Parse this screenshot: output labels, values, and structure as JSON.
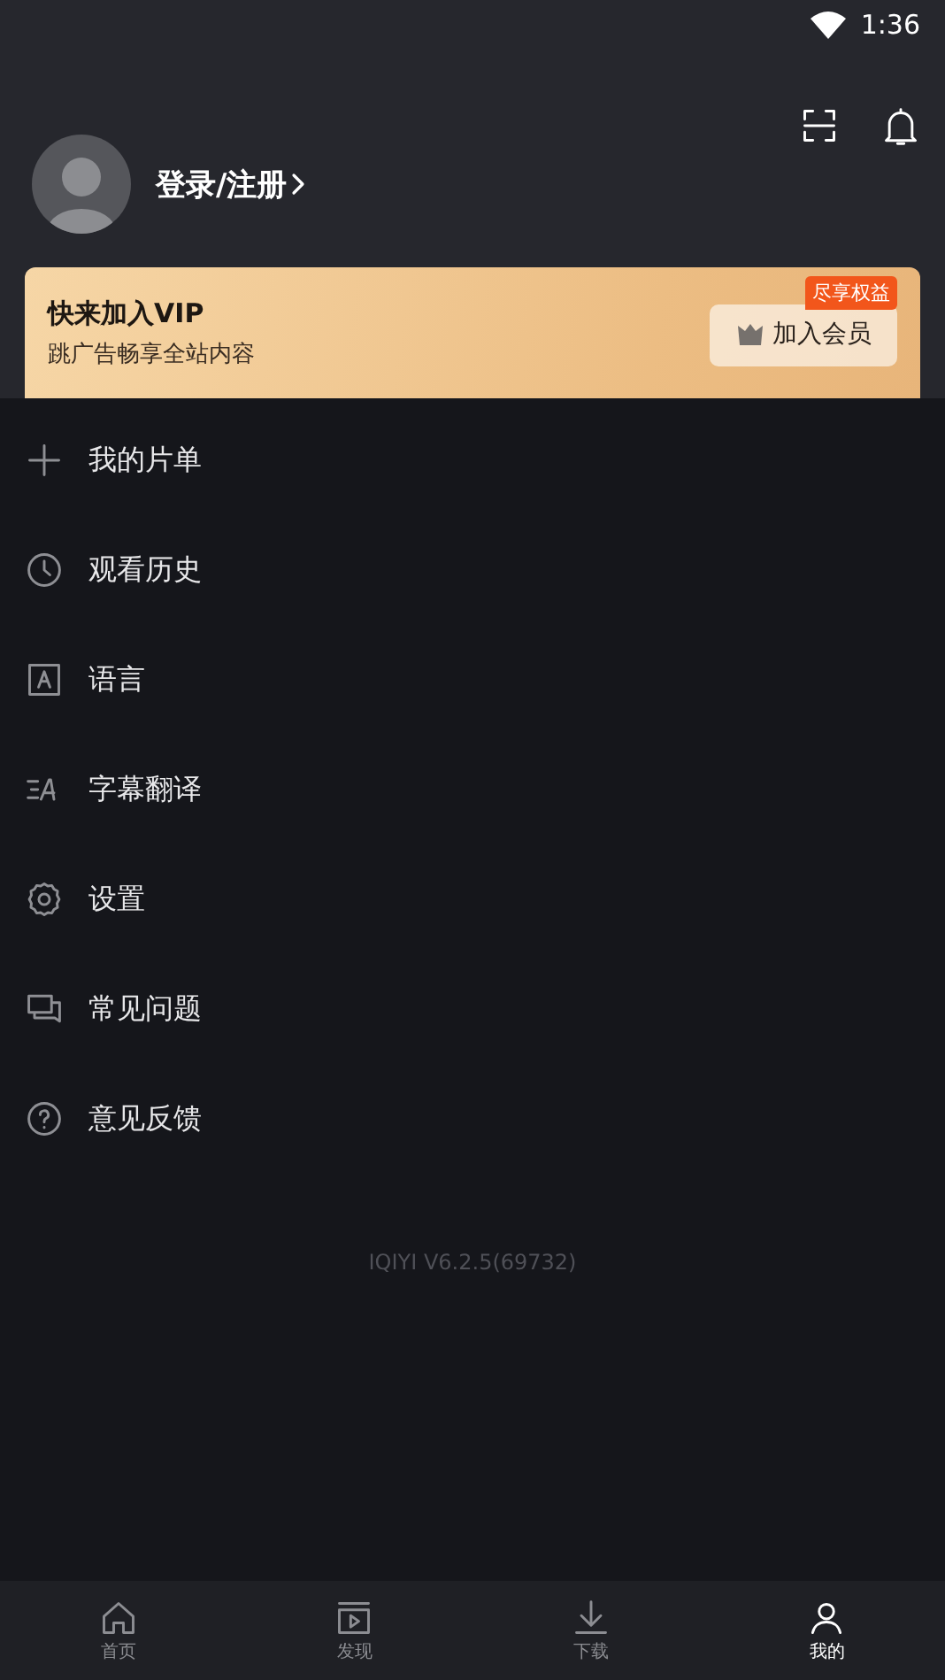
{
  "status_bar": {
    "time": "1:36"
  },
  "profile": {
    "login_label": "登录/注册"
  },
  "vip_banner": {
    "title": "快来加入VIP",
    "subtitle": "跳广告畅享全站内容",
    "badge": "尽享权益",
    "button": "加入会员"
  },
  "menu": [
    {
      "kind": "plus",
      "label": "我的片单"
    },
    {
      "kind": "clock",
      "label": "观看历史"
    },
    {
      "kind": "language",
      "label": "语言"
    },
    {
      "kind": "subtitle",
      "label": "字幕翻译"
    },
    {
      "kind": "gear",
      "label": "设置"
    },
    {
      "kind": "chat",
      "label": "常见问题"
    },
    {
      "kind": "help",
      "label": "意见反馈"
    }
  ],
  "version": "IQIYI V6.2.5(69732)",
  "bottom_nav": [
    {
      "kind": "home",
      "label": "首页",
      "selected": false
    },
    {
      "kind": "discover",
      "label": "发现",
      "selected": false
    },
    {
      "kind": "download",
      "label": "下载",
      "selected": false
    },
    {
      "kind": "me",
      "label": "我的",
      "selected": true
    }
  ]
}
